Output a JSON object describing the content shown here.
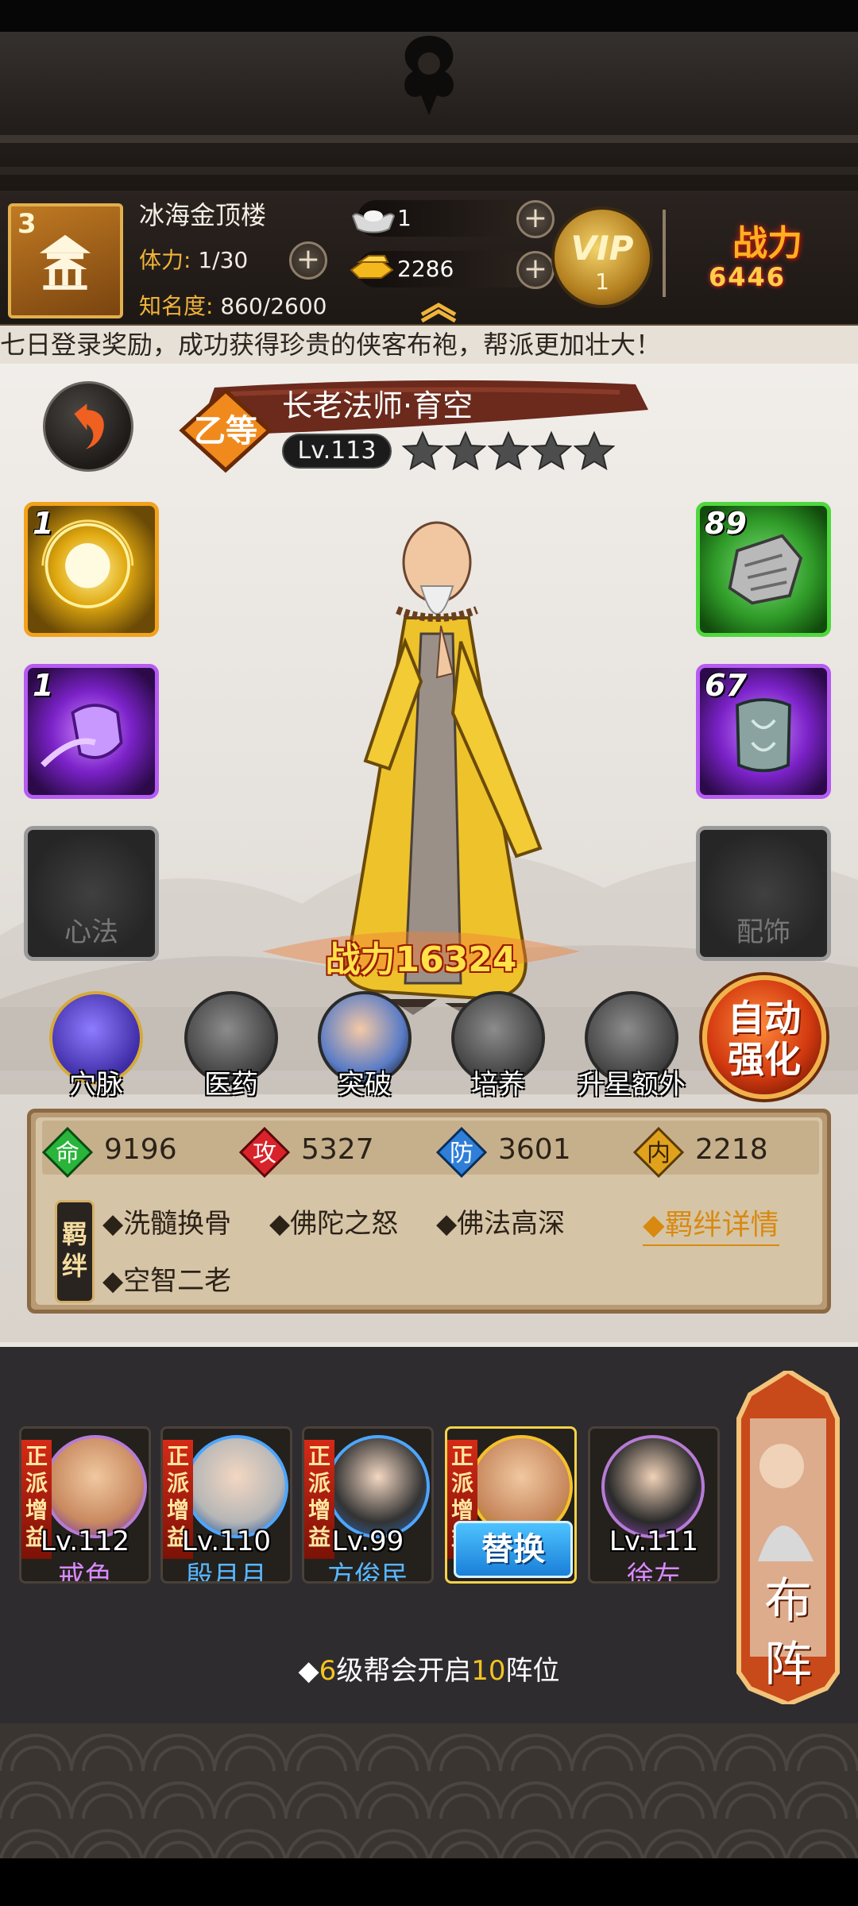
{
  "header": {
    "guild_level": "3",
    "guild_name": "冰海金顶楼",
    "stamina_label": "体力:",
    "stamina_value": "1/30",
    "fame_label": "知名度:",
    "fame_value": "860/2600",
    "silver": "1",
    "gold": "2286",
    "vip_label": "VIP",
    "vip_level": "1",
    "power_label": "战力",
    "power_value": "6446"
  },
  "marquee": "七日登录奖励，成功获得珍贵的侠客布袍，帮派更加壮大！",
  "hero": {
    "grade": "乙等",
    "name": "长老法师·育空",
    "level": "Lv.113",
    "stars": 5,
    "power_label": "战力",
    "power_value": "16324"
  },
  "slots": {
    "skill1_level": "1",
    "skill2_level": "1",
    "equip1_level": "89",
    "equip2_level": "67",
    "heart_method": "心法",
    "accessory": "配饰"
  },
  "functions": [
    "穴脉",
    "医药",
    "突破",
    "培养",
    "升星额外"
  ],
  "auto_button": [
    "自动",
    "强化"
  ],
  "attributes": [
    {
      "icon": "命",
      "value": "9196",
      "color": "#28b53a"
    },
    {
      "icon": "攻",
      "value": "5327",
      "color": "#d8232a"
    },
    {
      "icon": "防",
      "value": "3601",
      "color": "#2f7ed8"
    },
    {
      "icon": "内",
      "value": "2218",
      "color": "#e0a21c"
    }
  ],
  "bond_tag": "羁绊",
  "bonds": [
    "◆洗髓换骨",
    "◆佛陀之怒",
    "◆佛法高深",
    "◆空智二老"
  ],
  "bond_detail": "◆羁绊详情",
  "roster": [
    {
      "tag": "正派增益",
      "level": "Lv.112",
      "name": "戒色",
      "name_color": "#d88bff"
    },
    {
      "tag": "正派增益",
      "level": "Lv.110",
      "name": "殷月月",
      "name_color": "#57b7ff"
    },
    {
      "tag": "正派增益",
      "level": "Lv.99",
      "name": "方俊民",
      "name_color": "#57b7ff"
    },
    {
      "tag": "正派增益",
      "level": "",
      "name": "",
      "name_color": "#ffffff"
    },
    {
      "tag": "",
      "level": "Lv.111",
      "name": "徐左",
      "name_color": "#d88bff"
    }
  ],
  "swap_button": "替换",
  "formation_button": "布阵",
  "tip": {
    "prefix": "◆",
    "num1": "6",
    "mid": "级帮会开启",
    "num2": "10",
    "suffix": "阵位"
  }
}
